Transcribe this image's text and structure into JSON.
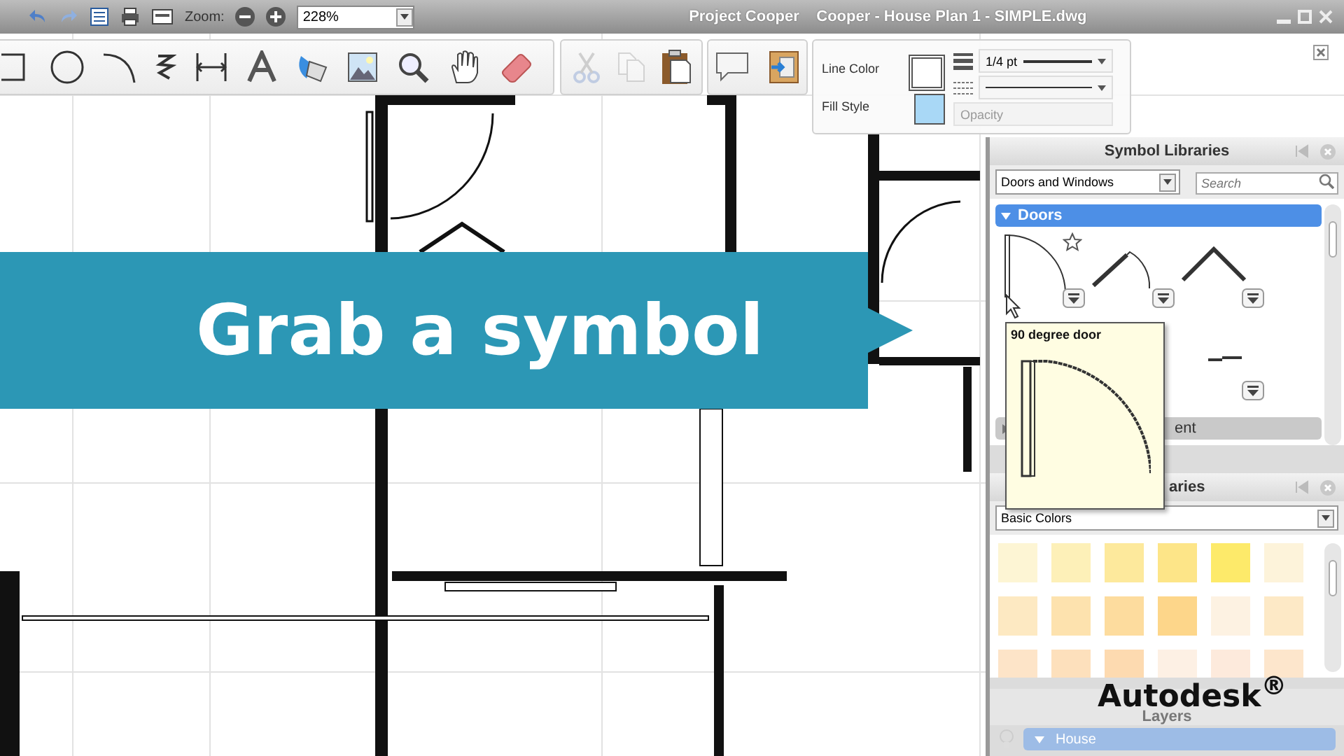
{
  "window": {
    "title": "Project Cooper    Cooper - House Plan 1 - SIMPLE.dwg"
  },
  "quick_toolbar": {
    "zoom_label": "Zoom:",
    "zoom_value": "228%"
  },
  "edit_tools": [
    {
      "disabled": true
    },
    {
      "disabled": true
    },
    {
      "disabled": false
    }
  ],
  "properties": {
    "line_color_label": "Line Color",
    "fill_style_label": "Fill Style",
    "line_weight": "1/4 pt",
    "opacity_placeholder": "Opacity"
  },
  "symbol_panel": {
    "title": "Symbol Libraries",
    "library": "Doors and Windows",
    "search_placeholder": "Search",
    "categories": [
      {
        "name": "Doors",
        "expanded": true
      },
      {
        "name": "ent",
        "expanded": false
      }
    ],
    "symbols": [
      {
        "starred": true
      },
      {
        "starred": false
      },
      {
        "starred": false
      }
    ]
  },
  "tooltip": {
    "title": "90 degree door"
  },
  "color_panel": {
    "title": "aries",
    "palette": "Basic Colors",
    "swatches": [
      {
        "color": "#fdf5d4"
      },
      {
        "color": "#fdf0b8"
      },
      {
        "color": "#fde99c"
      },
      {
        "color": "#fde588"
      },
      {
        "color": "#fdea6a"
      },
      {
        "color": "#fdf3da"
      },
      {
        "color": "#fde9c2"
      },
      {
        "color": "#fde2ae"
      },
      {
        "color": "#fddc9e"
      },
      {
        "color": "#fdd68a"
      },
      {
        "color": "#fdf2e2"
      },
      {
        "color": "#fde9c6"
      },
      {
        "color": "#fde4c8"
      },
      {
        "color": "#fde0bc"
      },
      {
        "color": "#fddab0"
      },
      {
        "color": "#fdf0e4"
      },
      {
        "color": "#fdeadc"
      },
      {
        "color": "#fde6cc"
      }
    ]
  },
  "layers_panel": {
    "title": "Layers",
    "layer": "House"
  },
  "banner": {
    "text": "Grab a symbol"
  },
  "logo": {
    "text": "Autodesk$^{®}$"
  }
}
